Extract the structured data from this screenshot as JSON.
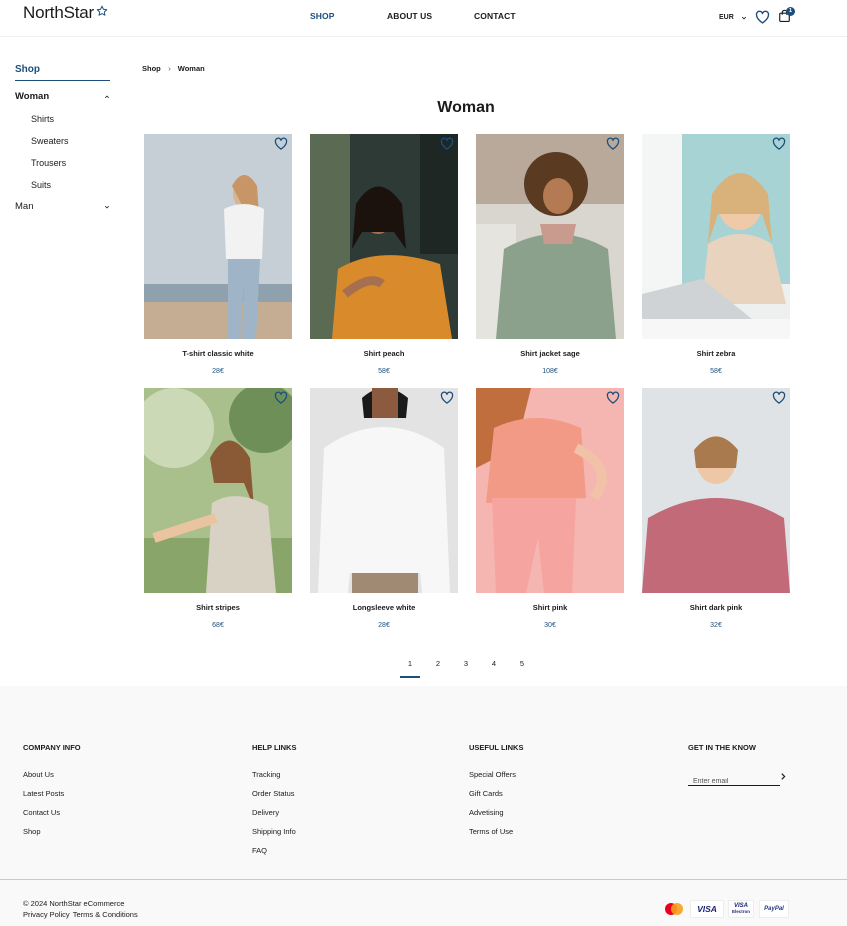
{
  "header": {
    "logo": "NorthStar",
    "nav": [
      {
        "label": "SHOP",
        "active": true
      },
      {
        "label": "ABOUT US",
        "active": false
      },
      {
        "label": "CONTACT",
        "active": false
      }
    ],
    "currency": "EUR",
    "cart_count": "1"
  },
  "sidebar": {
    "title": "Shop",
    "categories": [
      {
        "label": "Woman",
        "expanded": true,
        "items": [
          "Shirts",
          "Sweaters",
          "Trousers",
          "Suits"
        ]
      },
      {
        "label": "Man",
        "expanded": false,
        "items": []
      }
    ]
  },
  "breadcrumb": [
    "Shop",
    "Woman"
  ],
  "page_title": "Woman",
  "products": [
    {
      "name": "T-shirt classic white",
      "price": "28€"
    },
    {
      "name": "Shirt peach",
      "price": "58€"
    },
    {
      "name": "Shirt jacket sage",
      "price": "108€"
    },
    {
      "name": "Shirt zebra",
      "price": "58€"
    },
    {
      "name": "Shirt stripes",
      "price": "68€"
    },
    {
      "name": "Longsleeve white",
      "price": "28€"
    },
    {
      "name": "Shirt pink",
      "price": "30€"
    },
    {
      "name": "Shirt dark pink",
      "price": "32€"
    }
  ],
  "pagination": {
    "pages": [
      "1",
      "2",
      "3",
      "4",
      "5"
    ],
    "current": "1"
  },
  "footer": {
    "columns": [
      {
        "title": "COMPANY INFO",
        "links": [
          "About Us",
          "Latest Posts",
          "Contact Us",
          "Shop"
        ]
      },
      {
        "title": "HELP LINKS",
        "links": [
          "Tracking",
          "Order Status",
          "Delivery",
          "Shipping Info",
          "FAQ"
        ]
      },
      {
        "title": "USEFUL LINKS",
        "links": [
          "Special Offers",
          "Gift Cards",
          "Advetising",
          "Terms of Use"
        ]
      }
    ],
    "newsletter": {
      "title": "GET IN THE KNOW",
      "placeholder": "Enter email"
    },
    "copyright": "© 2024 NorthStar eCommerce",
    "legal": [
      "Privacy Policy",
      "Terms & Conditions"
    ],
    "payments": [
      "mastercard-icon",
      "VISA",
      "VISA Electron",
      "PayPal"
    ],
    "visa_label": "VISA",
    "visa_electron": {
      "brand": "VISA",
      "sub": "Electron"
    },
    "paypal_label": "PayPal"
  },
  "colors": {
    "accent": "#1c4f7c",
    "footer_bg": "#f9f9f9",
    "text": "#1b1b1b"
  }
}
